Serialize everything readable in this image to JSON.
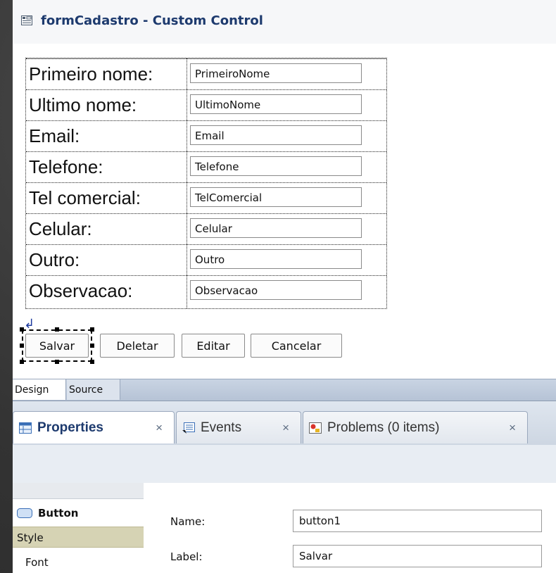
{
  "editor": {
    "title": "formCadastro - Custom Control"
  },
  "form": {
    "rows": [
      {
        "label": "Primeiro nome:",
        "value": "PrimeiroNome"
      },
      {
        "label": "Ultimo nome:",
        "value": "UltimoNome"
      },
      {
        "label": "Email:",
        "value": "Email"
      },
      {
        "label": "Telefone:",
        "value": "Telefone"
      },
      {
        "label": "Tel comercial:",
        "value": "TelComercial"
      },
      {
        "label": "Celular:",
        "value": "Celular"
      },
      {
        "label": "Outro:",
        "value": "Outro"
      },
      {
        "label": "Observacao:",
        "value": "Observacao"
      }
    ]
  },
  "buttons": {
    "salvar": "Salvar",
    "deletar": "Deletar",
    "editar": "Editar",
    "cancelar": "Cancelar"
  },
  "design_tabs": {
    "design": "Design",
    "source": "Source"
  },
  "views": {
    "properties": "Properties",
    "events": "Events",
    "problems": "Problems (0 items)",
    "close_glyph": "×"
  },
  "properties_panel": {
    "sidebar": {
      "heading": "Button",
      "style": "Style",
      "font": "Font"
    },
    "fields": {
      "name_label": "Name:",
      "name_value": "button1",
      "label_label": "Label:",
      "label_value": "Salvar"
    }
  },
  "colors": {
    "title": "#1d3a6e",
    "selection": "#000000",
    "style_highlight": "#d6d3b4"
  }
}
